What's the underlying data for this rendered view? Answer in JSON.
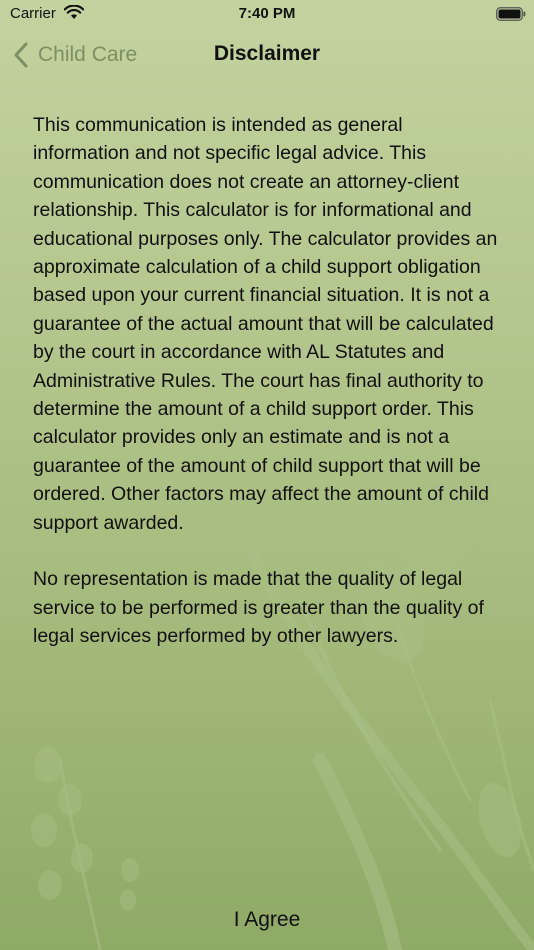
{
  "status_bar": {
    "carrier": "Carrier",
    "time": "7:40 PM",
    "wifi_icon": "wifi-icon",
    "battery_icon": "battery-icon"
  },
  "nav": {
    "back_label": "Child Care",
    "back_icon": "chevron-left-icon",
    "title": "Disclaimer"
  },
  "disclaimer": {
    "paragraph_1": "This communication is intended as general information and not specific legal advice. This communication does not create an attorney-client relationship. This calculator is for informational and educational purposes only. The calculator provides an approximate calculation of a child support obligation based upon your current financial situation. It is not a guarantee of the actual amount that will be calculated by the court in accordance with AL Statutes and Administrative Rules. The court has final authority to determine the amount of a child support order. This calculator provides only an estimate and is not a guarantee of the amount of child support that will be ordered. Other factors may affect the amount of child support awarded.",
    "paragraph_2": "No representation is made that the quality of legal service to be performed is greater than the quality of legal services performed by other lawyers."
  },
  "footer": {
    "agree_label": "I Agree"
  },
  "colors": {
    "background_top": "#c3d3a0",
    "background_bottom": "#8fa967",
    "back_label": "#7d8f63",
    "text": "#111111"
  }
}
